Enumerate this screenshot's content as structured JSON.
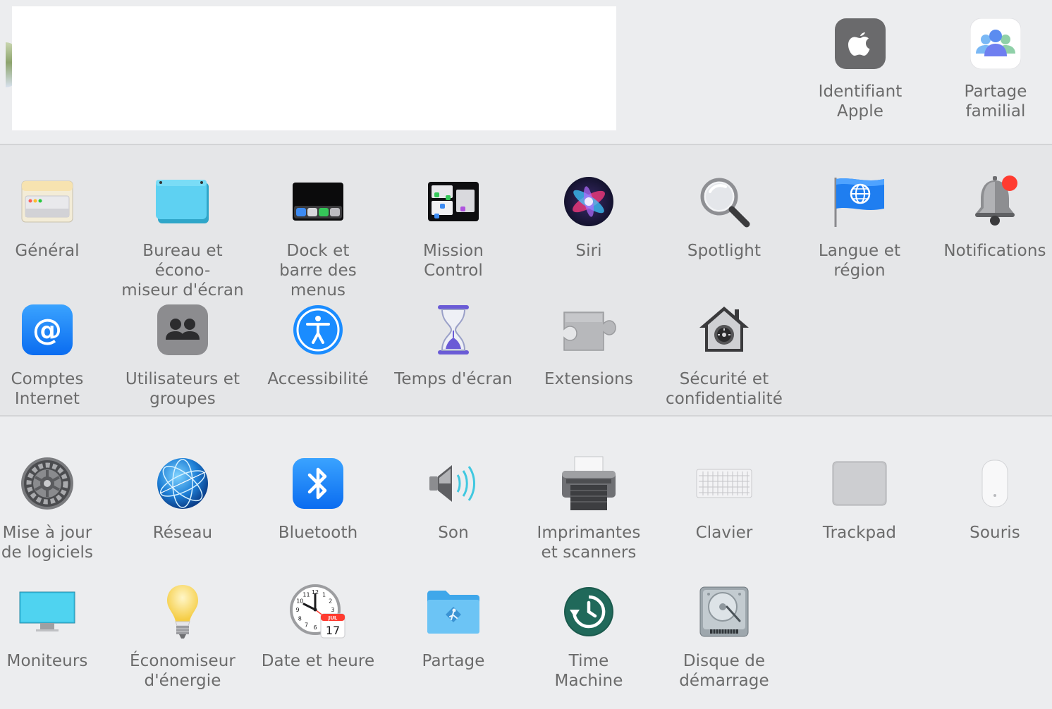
{
  "account": {
    "items": [
      {
        "id": "apple-id",
        "label": "Identifiant\nApple"
      },
      {
        "id": "family",
        "label": "Partage\nfamilial"
      }
    ]
  },
  "panes_row1": [
    {
      "id": "general",
      "label": "Général"
    },
    {
      "id": "desktop",
      "label": "Bureau et écono-\nmiseur d'écran"
    },
    {
      "id": "dock",
      "label": "Dock et\nbarre des menus"
    },
    {
      "id": "mission",
      "label": "Mission\nControl"
    },
    {
      "id": "siri",
      "label": "Siri"
    },
    {
      "id": "spotlight",
      "label": "Spotlight"
    },
    {
      "id": "language",
      "label": "Langue et\nrégion"
    },
    {
      "id": "notifications",
      "label": "Notifications"
    }
  ],
  "panes_row2": [
    {
      "id": "internet",
      "label": "Comptes\nInternet"
    },
    {
      "id": "users",
      "label": "Utilisateurs et\ngroupes"
    },
    {
      "id": "accessibility",
      "label": "Accessibilité"
    },
    {
      "id": "screentime",
      "label": "Temps d'écran"
    },
    {
      "id": "extensions",
      "label": "Extensions"
    },
    {
      "id": "security",
      "label": "Sécurité et\nconfidentialité"
    }
  ],
  "panes_row3": [
    {
      "id": "update",
      "label": "Mise à jour\nde logiciels"
    },
    {
      "id": "network",
      "label": "Réseau"
    },
    {
      "id": "bluetooth",
      "label": "Bluetooth"
    },
    {
      "id": "sound",
      "label": "Son"
    },
    {
      "id": "printers",
      "label": "Imprimantes\net scanners"
    },
    {
      "id": "keyboard",
      "label": "Clavier"
    },
    {
      "id": "trackpad",
      "label": "Trackpad"
    },
    {
      "id": "mouse",
      "label": "Souris"
    }
  ],
  "panes_row4": [
    {
      "id": "displays",
      "label": "Moniteurs"
    },
    {
      "id": "energy",
      "label": "Économiseur\nd'énergie"
    },
    {
      "id": "datetime",
      "label": "Date et heure",
      "calendar_month": "JUL",
      "calendar_day": "17"
    },
    {
      "id": "sharing",
      "label": "Partage"
    },
    {
      "id": "timemachine",
      "label": "Time\nMachine"
    },
    {
      "id": "startup",
      "label": "Disque de\ndémarrage"
    }
  ],
  "clock_numbers": [
    "12",
    "1",
    "2",
    "3",
    "4",
    "5",
    "6",
    "7",
    "8",
    "9",
    "10",
    "11"
  ],
  "colors": {
    "background_top": "#ecedef",
    "background_mid": "#e5e6e8",
    "label": "#6b6b6b",
    "accent_blue": "#1a8cff"
  }
}
